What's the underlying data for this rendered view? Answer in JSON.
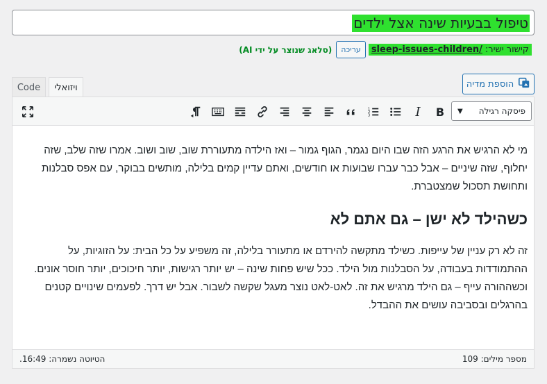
{
  "post": {
    "title": "טיפול בבעיות שינה אצל ילדים",
    "permalink_label": "קישור ישיר:",
    "permalink_slug": "/sleep-issues-children",
    "edit_label": "עריכה",
    "ai_note": "(סלאג שנוצר על ידי AI)"
  },
  "media": {
    "add_media_label": "הוספת מדיה",
    "icon": "add-media-icon"
  },
  "tabs": {
    "visual": "ויזואלי",
    "code": "Code"
  },
  "toolbar": {
    "format_value": "פיסקה רגילה",
    "buttons": [
      "bold",
      "italic",
      "bulleted-list",
      "numbered-list",
      "blockquote",
      "align-left",
      "align-center",
      "align-right",
      "insert-link",
      "read-more",
      "toolbar-toggle",
      "paragraph-direction",
      "fullscreen"
    ]
  },
  "content": {
    "paragraph1": "מי לא הרגיש את הרגע הזה שבו היום נגמר, הגוף גמור – ואז הילדה מתעוררת שוב, שוב ושוב. אמרו שזה שלב, שזה יחלוף, שזה שיניים – אבל כבר עברו שבועות או חודשים, ואתם עדיין קמים בלילה, מותשים בבוקר, עם אפס סבלנות ותחושת תסכול שמצטברת.",
    "heading": "כשהילד לא ישן – גם אתם לא",
    "paragraph2": "זה לא רק עניין של עייפות. כשילד מתקשה להירדם או מתעורר בלילה, זה משפיע על כל הבית: על הזוגיות, על ההתמודדות בעבודה, על הסבלנות מול הילד. ככל שיש פחות שינה – יש יותר רגישות, יותר חיכוכים, יותר חוסר אונים. וכשההורה עייף – גם הילד מרגיש את זה. לאט-לאט נוצר מעגל שקשה לשבור. אבל יש דרך. לפעמים שינויים קטנים בהרגלים ובסביבה עושים את ההבדל."
  },
  "status": {
    "word_count": "מספר מילים: 109",
    "draft_saved": "הטיוטה נשמרה: 16:49."
  },
  "colors": {
    "accent": "#2271b1",
    "highlight": "#2fe02f",
    "ai_note": "#008a20"
  }
}
